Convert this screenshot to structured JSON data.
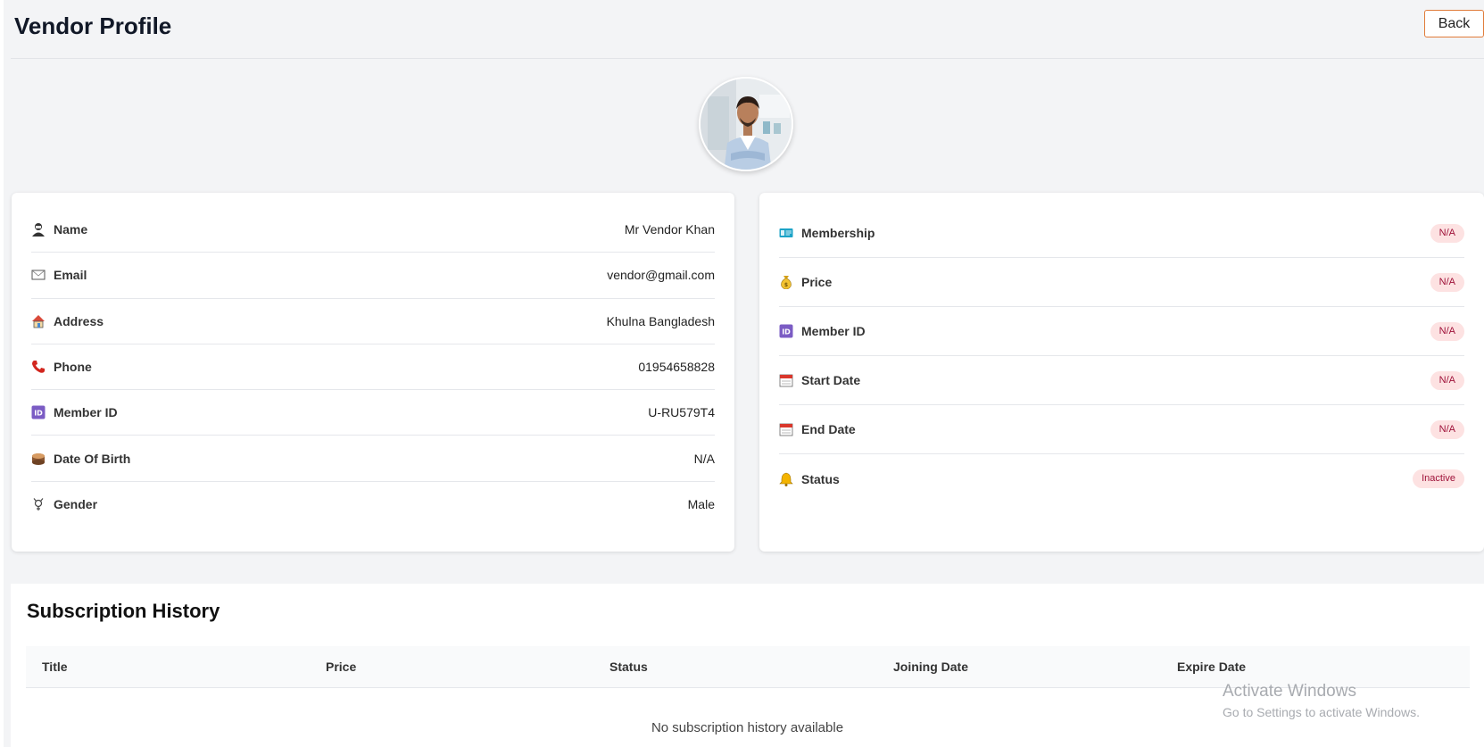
{
  "header": {
    "title": "Vendor Profile",
    "back_label": "Back"
  },
  "profile": {
    "rows": [
      {
        "icon": "user-icon",
        "label": "Name",
        "value": "Mr Vendor Khan"
      },
      {
        "icon": "envelope-icon",
        "label": "Email",
        "value": "vendor@gmail.com"
      },
      {
        "icon": "house-icon",
        "label": "Address",
        "value": "Khulna Bangladesh"
      },
      {
        "icon": "phone-icon",
        "label": "Phone",
        "value": "01954658828"
      },
      {
        "icon": "id-icon",
        "label": "Member ID",
        "value": "U-RU579T4"
      },
      {
        "icon": "cake-icon",
        "label": "Date Of Birth",
        "value": "N/A"
      },
      {
        "icon": "gender-icon",
        "label": "Gender",
        "value": "Male"
      }
    ]
  },
  "membership": {
    "rows": [
      {
        "icon": "membership-card-icon",
        "label": "Membership",
        "value": "N/A"
      },
      {
        "icon": "money-bag-icon",
        "label": "Price",
        "value": "N/A"
      },
      {
        "icon": "id-icon",
        "label": "Member ID",
        "value": "N/A"
      },
      {
        "icon": "calendar-icon",
        "label": "Start Date",
        "value": "N/A"
      },
      {
        "icon": "calendar-icon",
        "label": "End Date",
        "value": "N/A"
      },
      {
        "icon": "bell-icon",
        "label": "Status",
        "value": "Inactive"
      }
    ]
  },
  "subscription": {
    "title": "Subscription History",
    "columns": [
      "Title",
      "Price",
      "Status",
      "Joining Date",
      "Expire Date"
    ],
    "empty_message": "No subscription history available"
  },
  "watermark": {
    "title": "Activate Windows",
    "subtitle": "Go to Settings to activate Windows."
  },
  "colors": {
    "badge_bg": "#fde2e2",
    "badge_text": "#9f1239",
    "back_border": "#e07b39"
  }
}
